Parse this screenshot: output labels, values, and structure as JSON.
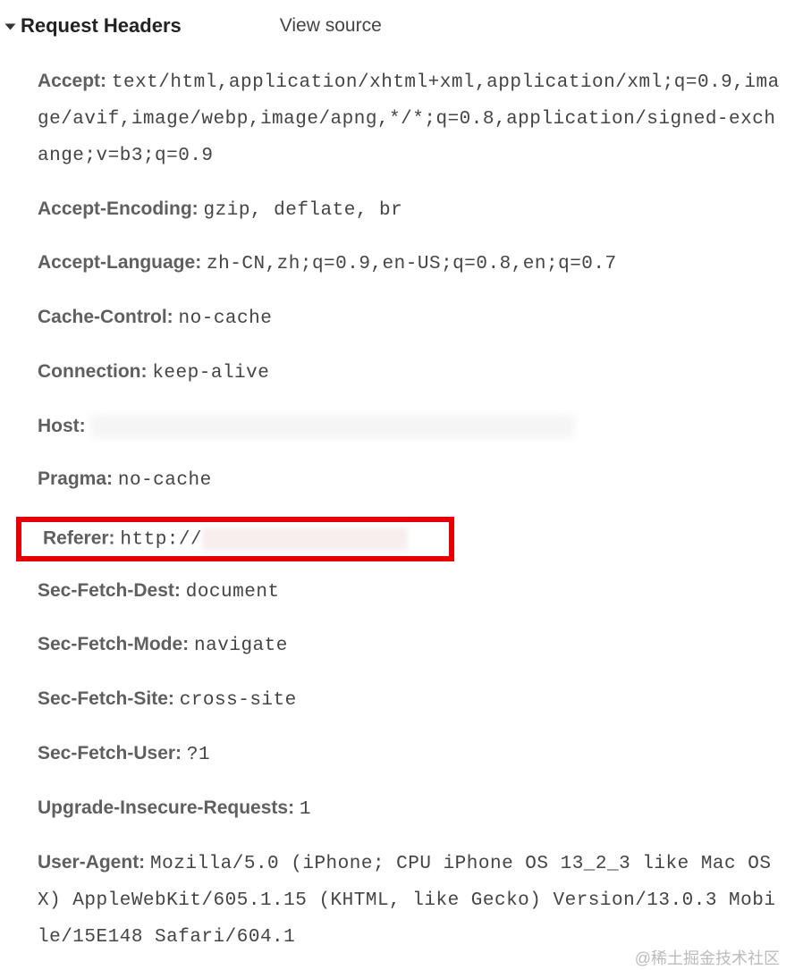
{
  "section": {
    "title": "Request Headers",
    "view_source": "View source"
  },
  "headers": {
    "accept": {
      "name": "Accept:",
      "value": "text/html,application/xhtml+xml,application/xml;q=0.9,image/avif,image/webp,image/apng,*/*;q=0.8,application/signed-exchange;v=b3;q=0.9"
    },
    "accept_encoding": {
      "name": "Accept-Encoding:",
      "value": "gzip, deflate, br"
    },
    "accept_language": {
      "name": "Accept-Language:",
      "value": "zh-CN,zh;q=0.9,en-US;q=0.8,en;q=0.7"
    },
    "cache_control": {
      "name": "Cache-Control:",
      "value": "no-cache"
    },
    "connection": {
      "name": "Connection:",
      "value": "keep-alive"
    },
    "host": {
      "name": "Host:",
      "value": ""
    },
    "pragma": {
      "name": "Pragma:",
      "value": "no-cache"
    },
    "referer": {
      "name": "Referer:",
      "value_prefix": "http://"
    },
    "sec_fetch_dest": {
      "name": "Sec-Fetch-Dest:",
      "value": "document"
    },
    "sec_fetch_mode": {
      "name": "Sec-Fetch-Mode:",
      "value": "navigate"
    },
    "sec_fetch_site": {
      "name": "Sec-Fetch-Site:",
      "value": "cross-site"
    },
    "sec_fetch_user": {
      "name": "Sec-Fetch-User:",
      "value": "?1"
    },
    "upgrade_insecure": {
      "name": "Upgrade-Insecure-Requests:",
      "value": "1"
    },
    "user_agent": {
      "name": "User-Agent:",
      "value": "Mozilla/5.0 (iPhone; CPU iPhone OS 13_2_3 like Mac OS X) AppleWebKit/605.1.15 (KHTML, like Gecko) Version/13.0.3 Mobile/15E148 Safari/604.1"
    }
  },
  "watermark": "@稀土掘金技术社区"
}
